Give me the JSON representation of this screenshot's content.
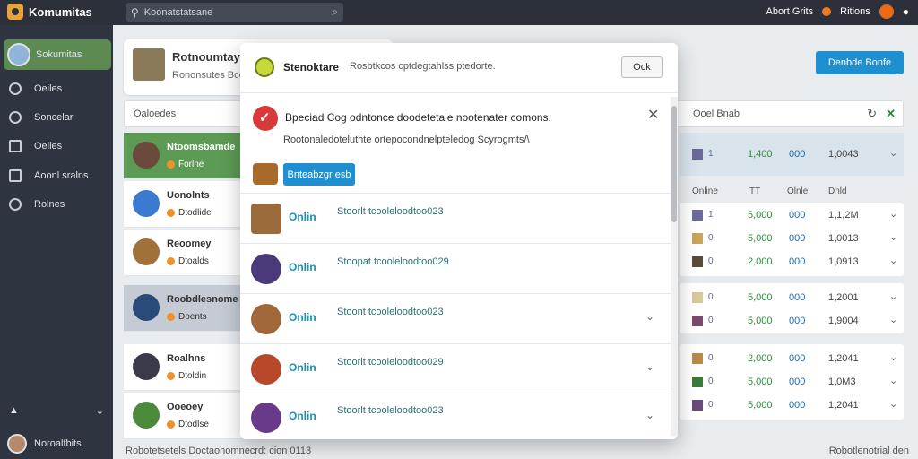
{
  "app": {
    "name": "Komumitas"
  },
  "search": {
    "placeholder": "Koonatstatsane"
  },
  "top_right": {
    "link1": "Abort Grits",
    "link2": "Ritions"
  },
  "sidebar": {
    "active_user": "Sokumitas",
    "items": [
      {
        "label": "Oeiles",
        "icon": "circle-icon"
      },
      {
        "label": "Soncelar",
        "icon": "person-icon"
      },
      {
        "label": "Oeiles",
        "icon": "grid-icon"
      },
      {
        "label": "Aoonl sralns",
        "icon": "board-icon"
      },
      {
        "label": "Rolnes",
        "icon": "pin-icon"
      }
    ],
    "bottom_user": "Noroalfbits"
  },
  "profile": {
    "name": "Rotnoumtay",
    "sub": "Rononsutes Bcoe"
  },
  "primary_button": "Denbde Bonfe",
  "filter": {
    "left": "Oaloedes",
    "right": "Ooel Bnab"
  },
  "left_list": [
    {
      "name": "Ntoomsbamde",
      "sub": "Forlne"
    },
    {
      "name": "Uonolnts",
      "sub": "Dtodlide"
    },
    {
      "name": "Reoomey",
      "sub": "Dtoalds"
    },
    {
      "name": "Roobdlesnome",
      "sub": "Doents"
    },
    {
      "name": "Roalhns",
      "sub": "Dtoldin"
    },
    {
      "name": "Ooeoey",
      "sub": "Dtodlse"
    }
  ],
  "right_table": {
    "head_row": {
      "rank": "1",
      "pts": "1,400",
      "val": "000",
      "num": "1,0043"
    },
    "col_heads": [
      "Online",
      "TT",
      "Olnle",
      "Dnld"
    ],
    "rows": [
      {
        "rank": "1",
        "pts": "5,000",
        "val": "000",
        "num": "1,1,2M"
      },
      {
        "rank": "0",
        "pts": "5,000",
        "val": "000",
        "num": "1,0013"
      },
      {
        "rank": "0",
        "pts": "2,000",
        "val": "000",
        "num": "1,0913"
      },
      {
        "rank": "0",
        "pts": "5,000",
        "val": "000",
        "num": "1,2001"
      },
      {
        "rank": "0",
        "pts": "5,000",
        "val": "000",
        "num": "1,9004"
      },
      {
        "rank": "0",
        "pts": "2,000",
        "val": "000",
        "num": "1,2041"
      },
      {
        "rank": "0",
        "pts": "5,000",
        "val": "000",
        "num": "1,0M3"
      },
      {
        "rank": "0",
        "pts": "5,000",
        "val": "000",
        "num": "1,2041"
      }
    ]
  },
  "footer": {
    "left": "Robotetsetels Doctaohomnecrd: cion 0113",
    "right": "Robotlenotrial den"
  },
  "modal": {
    "title": "Stenoktare",
    "subtitle": "Rosbtkcos cptdegtahlss ptedorte.",
    "ok_label": "Ock",
    "notice_title": "Bpeciad Cog odntonce doodetetaie nootenater comons.",
    "notice_body": "Rootonaledoteluthte ortepocondnelpteledog Scyrogmts/\\",
    "notice_button": "Bnteabzgr esb",
    "rows": [
      {
        "status": "Onlin",
        "text": "Stoorlt tcooleloodtoo023"
      },
      {
        "status": "Onlin",
        "text": "Stoopat tcooleloodtoo029"
      },
      {
        "status": "Onlin",
        "text": "Stoont tcooleloodtoo023"
      },
      {
        "status": "Onlin",
        "text": "Stoorlt tcooleloodtoo029"
      },
      {
        "status": "Onlin",
        "text": "Stoorlt tcooleloodtoo023"
      }
    ]
  }
}
